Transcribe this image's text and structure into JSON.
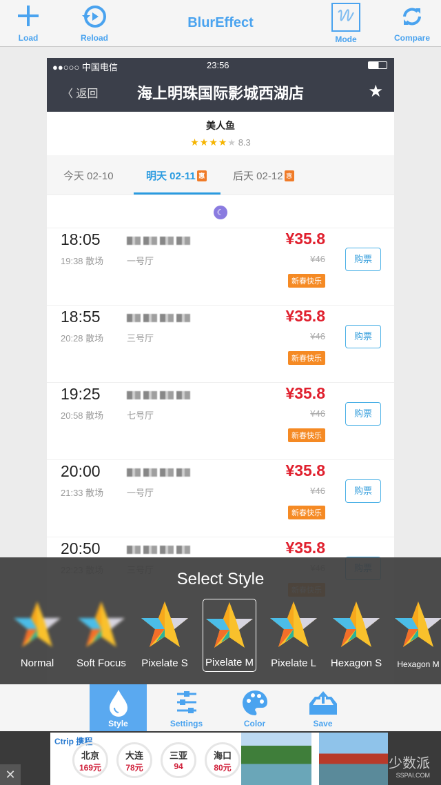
{
  "toolbar": {
    "title": "BlurEffect",
    "load": "Load",
    "reload": "Reload",
    "mode": "Mode",
    "compare": "Compare"
  },
  "phone": {
    "status": {
      "carrier": "●●○○○ 中国电信",
      "time": "23:56"
    },
    "nav": {
      "back": "〈 返回",
      "title": "海上明珠国际影城西湖店"
    },
    "movie": {
      "name": "美人鱼",
      "stars": "★★★★",
      "empty_star": "★",
      "score": "8.3"
    },
    "tabs": [
      {
        "label": "今天 02-10"
      },
      {
        "label": "明天 02-11",
        "badge": "惠"
      },
      {
        "label": "后天 02-12",
        "badge": "惠"
      }
    ],
    "rows": [
      {
        "time": "18:05",
        "end": "19:38 散场",
        "hall": "一号厅",
        "price": "¥35.8",
        "orig": "¥46",
        "badge": "新春快乐",
        "buy": "购票"
      },
      {
        "time": "18:55",
        "end": "20:28 散场",
        "hall": "三号厅",
        "price": "¥35.8",
        "orig": "¥46",
        "badge": "新春快乐",
        "buy": "购票"
      },
      {
        "time": "19:25",
        "end": "20:58 散场",
        "hall": "七号厅",
        "price": "¥35.8",
        "orig": "¥46",
        "badge": "新春快乐",
        "buy": "购票"
      },
      {
        "time": "20:00",
        "end": "21:33 散场",
        "hall": "一号厅",
        "price": "¥35.8",
        "orig": "¥46",
        "badge": "新春快乐",
        "buy": "购票"
      },
      {
        "time": "20:50",
        "end": "22:23 散场",
        "hall": "三号厅",
        "price": "¥35.8",
        "orig": "¥46",
        "badge": "新春快乐",
        "buy": "购票"
      }
    ]
  },
  "style_picker": {
    "title": "Select Style",
    "selected": "Pixelate M",
    "items": [
      "Normal",
      "Soft Focus",
      "Pixelate S",
      "Pixelate M",
      "Pixelate L",
      "Hexagon S",
      "Hexagon M"
    ]
  },
  "bottom_tabs": {
    "active": "Style",
    "style": "Style",
    "settings": "Settings",
    "color": "Color",
    "save": "Save"
  },
  "ad": {
    "logo": "Ctrip 携程",
    "cities": [
      {
        "name": "北京",
        "price": "169元"
      },
      {
        "name": "大连",
        "price": "78元"
      },
      {
        "name": "三亚",
        "price": "94"
      },
      {
        "name": "海口",
        "price": "80元"
      }
    ],
    "watermark": "少数派",
    "watermark_sub": "SSPAI.COM",
    "close": "✕"
  },
  "colors": {
    "accent": "#4aa3ef",
    "price": "#e0202e",
    "badge": "#f58a24",
    "navbar": "#3b3f4a"
  }
}
